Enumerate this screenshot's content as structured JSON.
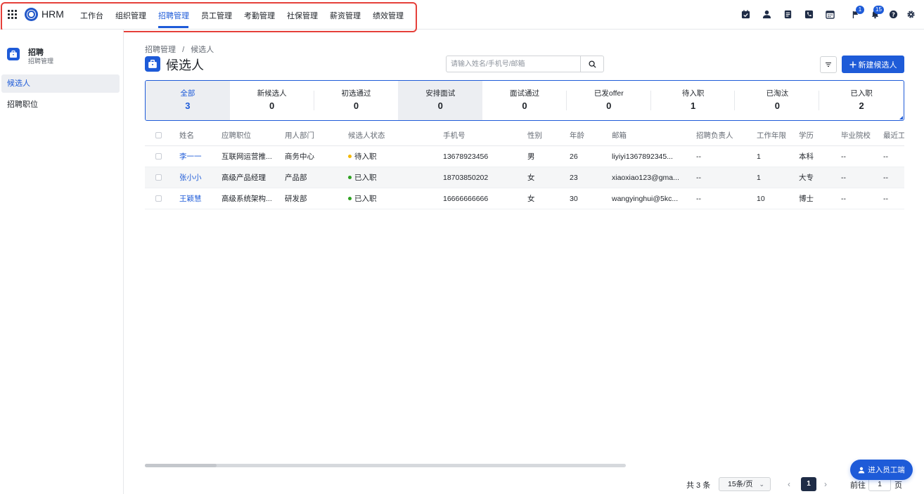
{
  "brand": "HRM",
  "nav": {
    "items": [
      "工作台",
      "组织管理",
      "招聘管理",
      "员工管理",
      "考勤管理",
      "社保管理",
      "薪资管理",
      "绩效管理"
    ],
    "active": "招聘管理"
  },
  "toolbar": {
    "icons": [
      "task-icon",
      "user-icon",
      "document-icon",
      "phone-icon",
      "calendar-icon",
      "flag-icon",
      "bell-icon",
      "help-icon",
      "settings-icon"
    ],
    "flag_badge": "1",
    "bell_badge": "15"
  },
  "sidebar": {
    "title": "招聘",
    "subtitle": "招聘管理",
    "items": [
      {
        "label": "候选人",
        "active": true
      },
      {
        "label": "招聘职位",
        "active": false
      }
    ]
  },
  "breadcrumb": {
    "parent": "招聘管理",
    "separator": "/",
    "current": "候选人"
  },
  "page_title": "候选人",
  "search": {
    "placeholder": "请输入姓名/手机号/邮箱",
    "value": ""
  },
  "new_button": "新建候选人",
  "status_tabs": [
    {
      "label": "全部",
      "count": "3"
    },
    {
      "label": "新候选人",
      "count": "0"
    },
    {
      "label": "初选通过",
      "count": "0"
    },
    {
      "label": "安排面试",
      "count": "0"
    },
    {
      "label": "面试通过",
      "count": "0"
    },
    {
      "label": "已发offer",
      "count": "0"
    },
    {
      "label": "待入职",
      "count": "1"
    },
    {
      "label": "已淘汰",
      "count": "0"
    },
    {
      "label": "已入职",
      "count": "2"
    }
  ],
  "table": {
    "columns": [
      "姓名",
      "应聘职位",
      "用人部门",
      "候选人状态",
      "手机号",
      "性别",
      "年龄",
      "邮箱",
      "招聘负责人",
      "工作年限",
      "学历",
      "毕业院校",
      "最近工"
    ],
    "rows": [
      {
        "name": "李一一",
        "position": "互联网运营推...",
        "dept": "商务中心",
        "status": "待入职",
        "status_color": "#f5b800",
        "phone": "13678923456",
        "gender": "男",
        "age": "26",
        "email": "liyiyi1367892345...",
        "recruiter": "--",
        "years": "1",
        "education": "本科",
        "school": "--",
        "recent": "--"
      },
      {
        "name": "张小小",
        "position": "高级产品经理",
        "dept": "产品部",
        "status": "已入职",
        "status_color": "#2ea121",
        "phone": "18703850202",
        "gender": "女",
        "age": "23",
        "email": "xiaoxiao123@gma...",
        "recruiter": "--",
        "years": "1",
        "education": "大专",
        "school": "--",
        "recent": "--"
      },
      {
        "name": "王颖慧",
        "position": "高级系统架构...",
        "dept": "研发部",
        "status": "已入职",
        "status_color": "#2ea121",
        "phone": "16666666666",
        "gender": "女",
        "age": "30",
        "email": "wangyinghui@5kc...",
        "recruiter": "--",
        "years": "10",
        "education": "博士",
        "school": "--",
        "recent": "--"
      }
    ]
  },
  "pagination": {
    "total": "共 3 条",
    "page_size": "15条/页",
    "current_page": "1",
    "goto_label": "前往",
    "goto_value": "1",
    "goto_suffix": "页"
  },
  "employee_portal_button": "进入员工端",
  "colors": {
    "accent": "#1e5bd8",
    "highlight_box": "#e5403a",
    "pending": "#f5b800",
    "joined": "#2ea121"
  }
}
